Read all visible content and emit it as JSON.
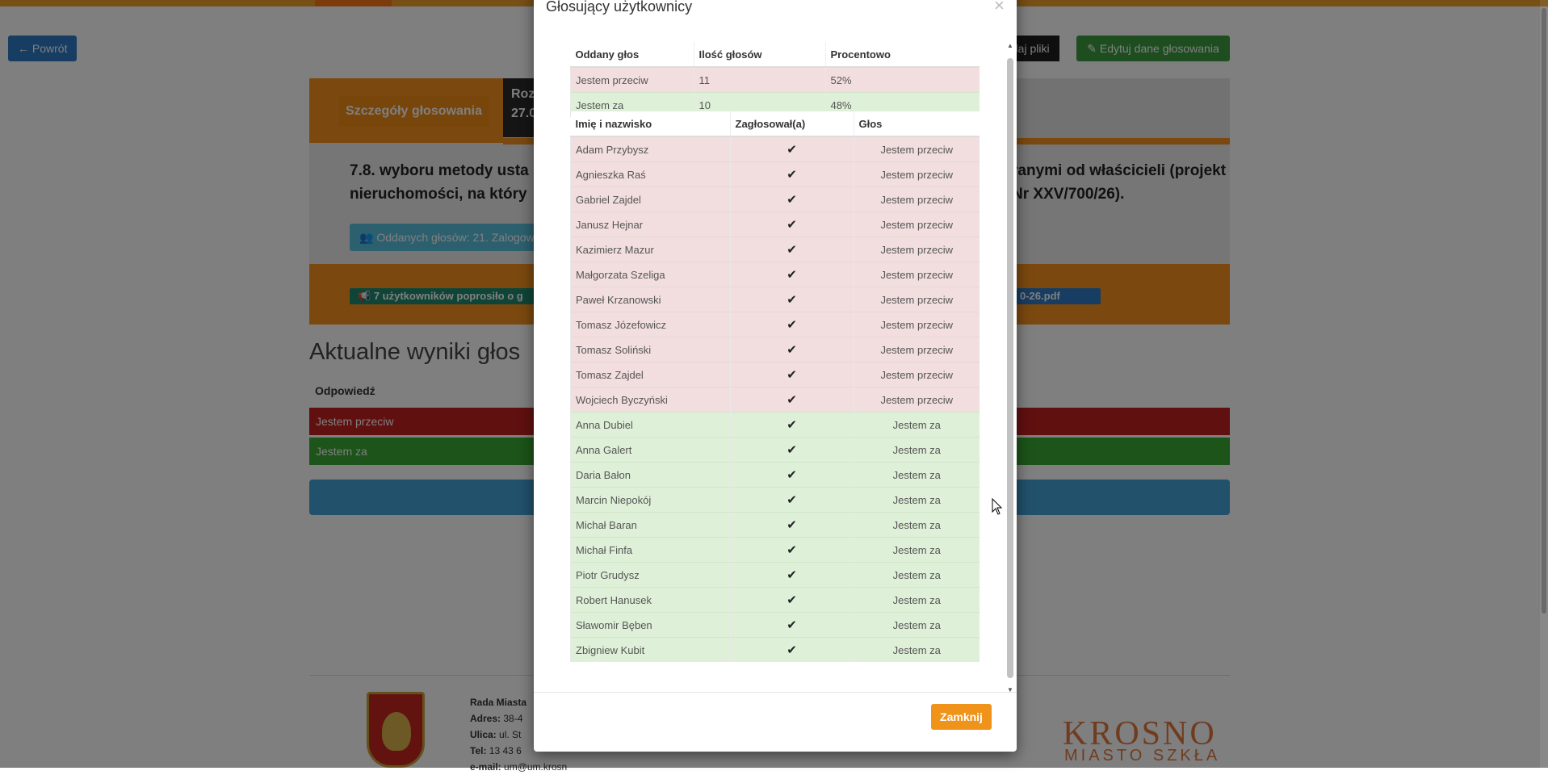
{
  "background": {
    "back_button": "← Powrót",
    "add_files_button": "Dodaj pliki",
    "edit_button": "Edytuj dane głosowania",
    "details_tab": "Szczegóły głosowania",
    "date_line1": "Roz",
    "date_line2": "27.0",
    "title_left": "7.8. wyboru metody usta nieruchomości, na który",
    "title_right": "ranymi od właścicieli (projekt Nr XXV/700/26).",
    "votes_button": "Oddanych głosów: 21. Zalogow",
    "request_badge": "7 użytkowników poprosiło o g",
    "file_badge": "0-26.pdf",
    "results_heading": "Aktualne wyniki głos",
    "results_column": "Odpowiedź",
    "results_rows": [
      "Jestem przeciw",
      "Jestem za"
    ],
    "footer": {
      "org": "Rada Miasta",
      "address_label": "Adres:",
      "address_value": "38-4",
      "street_label": "Ulica:",
      "street_value": "ul. St",
      "phone_label": "Tel:",
      "phone_value": "13 43 6",
      "email_label": "e-mail:",
      "email_value": "um@um.krosno.pl",
      "brand": "KROSNO",
      "brand_sub": "MIASTO SZKŁA"
    }
  },
  "modal": {
    "title": "Głosujący użytkownicy",
    "close_symbol": "×",
    "summary": {
      "headers": [
        "Oddany głos",
        "Ilość głosów",
        "Procentowo"
      ],
      "rows": [
        {
          "vote": "Jestem przeciw",
          "count": "11",
          "percent": "52%"
        },
        {
          "vote": "Jestem za",
          "count": "10",
          "percent": "48%"
        }
      ]
    },
    "voters": {
      "headers": [
        "Imię i nazwisko",
        "Zagłosował(a)",
        "Głos"
      ],
      "rows": [
        {
          "name": "Adam Przybysz",
          "vote": "Jestem przeciw"
        },
        {
          "name": "Agnieszka Raś",
          "vote": "Jestem przeciw"
        },
        {
          "name": "Gabriel Zajdel",
          "vote": "Jestem przeciw"
        },
        {
          "name": "Janusz Hejnar",
          "vote": "Jestem przeciw"
        },
        {
          "name": "Kazimierz Mazur",
          "vote": "Jestem przeciw"
        },
        {
          "name": "Małgorzata Szeliga",
          "vote": "Jestem przeciw"
        },
        {
          "name": "Paweł Krzanowski",
          "vote": "Jestem przeciw"
        },
        {
          "name": "Tomasz Józefowicz",
          "vote": "Jestem przeciw"
        },
        {
          "name": "Tomasz Soliński",
          "vote": "Jestem przeciw"
        },
        {
          "name": "Tomasz Zajdel",
          "vote": "Jestem przeciw"
        },
        {
          "name": "Wojciech Byczyński",
          "vote": "Jestem przeciw"
        },
        {
          "name": "Anna Dubiel",
          "vote": "Jestem za"
        },
        {
          "name": "Anna Galert",
          "vote": "Jestem za"
        },
        {
          "name": "Daria Bałon",
          "vote": "Jestem za"
        },
        {
          "name": "Marcin Niepokój",
          "vote": "Jestem za"
        },
        {
          "name": "Michał Baran",
          "vote": "Jestem za"
        },
        {
          "name": "Michał Finfa",
          "vote": "Jestem za"
        },
        {
          "name": "Piotr Grudysz",
          "vote": "Jestem za"
        },
        {
          "name": "Robert Hanusek",
          "vote": "Jestem za"
        },
        {
          "name": "Sławomir Bęben",
          "vote": "Jestem za"
        },
        {
          "name": "Zbigniew Kubit",
          "vote": "Jestem za"
        }
      ]
    },
    "close_button": "Zamknij"
  },
  "colors": {
    "against_row": "#f2dede",
    "for_row": "#dff0d8",
    "accent_orange": "#f0931a"
  },
  "icons": {
    "voted": "check-icon",
    "back": "arrow-left-icon",
    "edit": "edit-icon",
    "users": "users-icon",
    "megaphone": "megaphone-icon"
  }
}
